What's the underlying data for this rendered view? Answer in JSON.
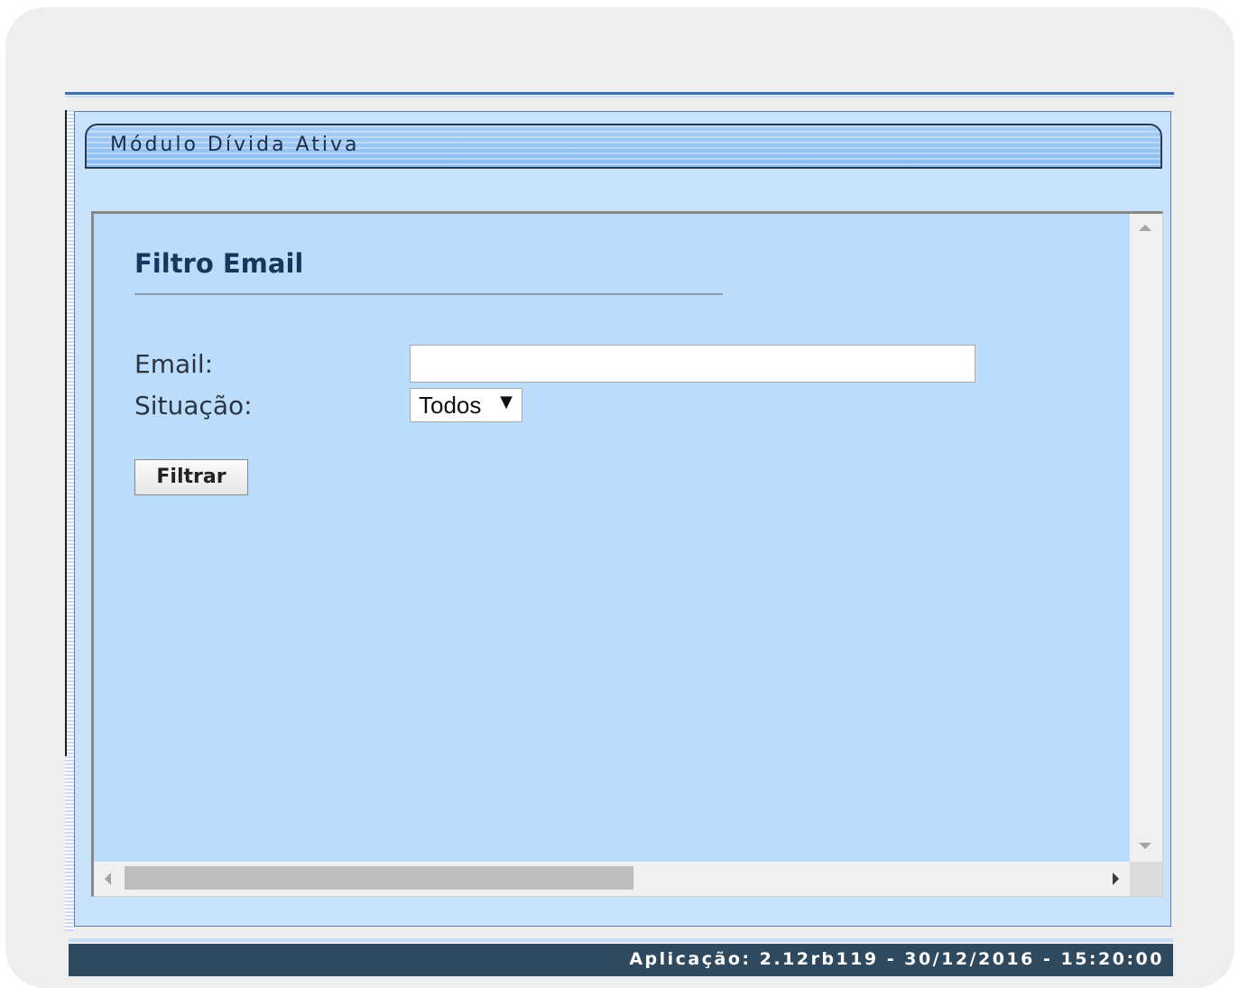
{
  "module": {
    "title": "Módulo Dívida Ativa"
  },
  "form": {
    "title": "Filtro Email",
    "email_label": "Email:",
    "email_value": "",
    "situacao_label": "Situação:",
    "situacao_selected": "Todos",
    "dropdown_icon": "▼",
    "filter_button_label": "Filtrar"
  },
  "footer": {
    "app_info": "Aplicação: 2.12rb119 - 30/12/2016 - 15:20:00"
  },
  "colors": {
    "header_bar": "#8bbcf0",
    "panel_background": "#c9e2fb",
    "content_background": "#bbdcfb",
    "title_text": "#15385e",
    "footer_background": "#2f4a5f",
    "top_rule": "#3b6db0"
  }
}
